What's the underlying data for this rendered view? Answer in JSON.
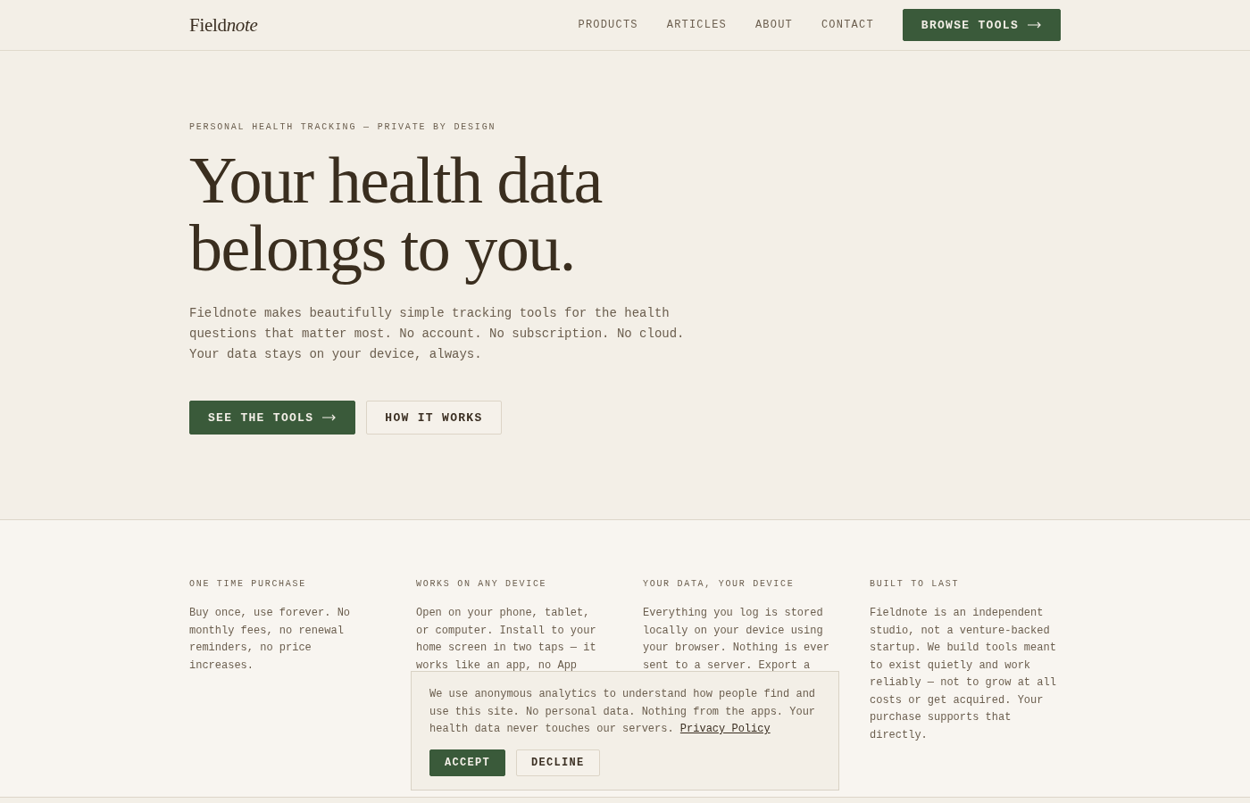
{
  "header": {
    "logo": {
      "plain": "Field",
      "italic": "note"
    },
    "nav": [
      {
        "label": "PRODUCTS"
      },
      {
        "label": "ARTICLES"
      },
      {
        "label": "ABOUT"
      },
      {
        "label": "CONTACT"
      }
    ],
    "cta": "BROWSE TOOLS"
  },
  "hero": {
    "eyebrow": "PERSONAL HEALTH TRACKING — PRIVATE BY DESIGN",
    "headline": [
      "Your health data",
      "belongs to you."
    ],
    "body": "Fieldnote makes beautifully simple tracking tools for the health questions that matter most. No account. No subscription. No cloud. Your data stays on your device, always.",
    "buttons": [
      {
        "label": "SEE THE TOOLS",
        "kind": "primary"
      },
      {
        "label": "HOW IT WORKS",
        "kind": "secondary"
      }
    ]
  },
  "features": [
    {
      "title": "ONE TIME PURCHASE",
      "text": "Buy once, use forever. No monthly fees, no renewal reminders, no price increases."
    },
    {
      "title": "WORKS ON ANY DEVICE",
      "text": "Open on your phone, tablet, or computer. Install to your home screen in two taps — it works like an app, no App"
    },
    {
      "title": "YOUR DATA, YOUR DEVICE",
      "text": "Everything you log is stored locally on your device using your browser. Nothing is ever sent to a server. Export a"
    },
    {
      "title": "BUILT TO LAST",
      "text": "Fieldnote is an independent studio, not a venture-backed startup. We build tools meant to exist quietly and work reliably — not to grow at all costs or get acquired. Your purchase supports that directly."
    }
  ],
  "cookie_banner": {
    "text": "We use anonymous analytics to understand how people find and use this site. No personal data. Nothing from the apps. Your health data never touches our servers.",
    "link": "Privacy Policy",
    "buttons": [
      {
        "label": "ACCEPT",
        "kind": "primary"
      },
      {
        "label": "DECLINE",
        "kind": "secondary"
      }
    ]
  }
}
